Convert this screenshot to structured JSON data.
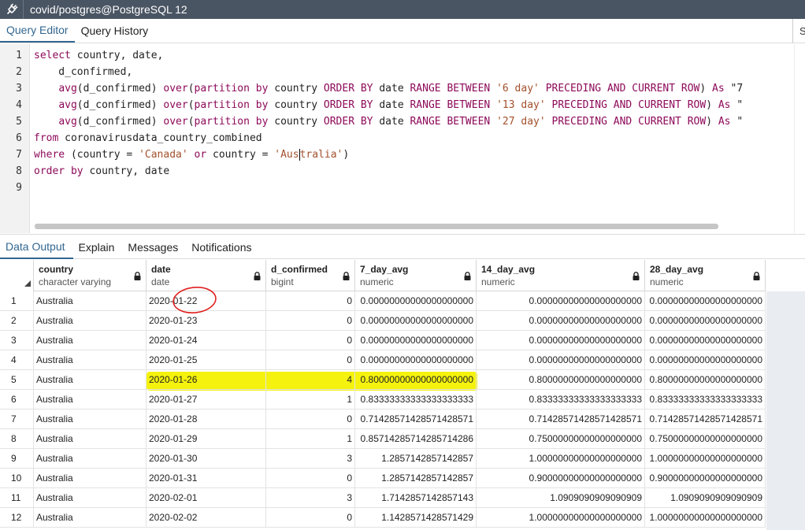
{
  "window": {
    "title": "covid/postgres@PostgreSQL 12",
    "app_icon": "plug-icon"
  },
  "editor_tabs": [
    {
      "label": "Query Editor",
      "active": true
    },
    {
      "label": "Query History",
      "active": false
    }
  ],
  "editor_tabs_overflow": "S",
  "editor": {
    "line_numbers": [
      "1",
      "2",
      "3",
      "4",
      "5",
      "6",
      "7",
      "8",
      "9"
    ],
    "lines": [
      [
        {
          "k": "kw",
          "t": "select"
        },
        {
          "k": "",
          "t": " country, date,"
        }
      ],
      [
        {
          "k": "",
          "t": "    d_confirmed,"
        }
      ],
      [
        {
          "k": "",
          "t": "    "
        },
        {
          "k": "kw",
          "t": "avg"
        },
        {
          "k": "",
          "t": "(d_confirmed) "
        },
        {
          "k": "kw",
          "t": "over"
        },
        {
          "k": "",
          "t": "("
        },
        {
          "k": "kw",
          "t": "partition by"
        },
        {
          "k": "",
          "t": " country "
        },
        {
          "k": "kw",
          "t": "ORDER BY"
        },
        {
          "k": "",
          "t": " date "
        },
        {
          "k": "kw",
          "t": "RANGE BETWEEN"
        },
        {
          "k": "",
          "t": " "
        },
        {
          "k": "str",
          "t": "'6 day'"
        },
        {
          "k": "",
          "t": " "
        },
        {
          "k": "kw",
          "t": "PRECEDING AND CURRENT ROW"
        },
        {
          "k": "",
          "t": ") "
        },
        {
          "k": "kw",
          "t": "As"
        },
        {
          "k": "",
          "t": " \"7"
        }
      ],
      [
        {
          "k": "",
          "t": "    "
        },
        {
          "k": "kw",
          "t": "avg"
        },
        {
          "k": "",
          "t": "(d_confirmed) "
        },
        {
          "k": "kw",
          "t": "over"
        },
        {
          "k": "",
          "t": "("
        },
        {
          "k": "kw",
          "t": "partition by"
        },
        {
          "k": "",
          "t": " country "
        },
        {
          "k": "kw",
          "t": "ORDER BY"
        },
        {
          "k": "",
          "t": " date "
        },
        {
          "k": "kw",
          "t": "RANGE BETWEEN"
        },
        {
          "k": "",
          "t": " "
        },
        {
          "k": "str",
          "t": "'13 day'"
        },
        {
          "k": "",
          "t": " "
        },
        {
          "k": "kw",
          "t": "PRECEDING AND CURRENT ROW"
        },
        {
          "k": "",
          "t": ") "
        },
        {
          "k": "kw",
          "t": "As"
        },
        {
          "k": "",
          "t": " \""
        }
      ],
      [
        {
          "k": "",
          "t": "    "
        },
        {
          "k": "kw",
          "t": "avg"
        },
        {
          "k": "",
          "t": "(d_confirmed) "
        },
        {
          "k": "kw",
          "t": "over"
        },
        {
          "k": "",
          "t": "("
        },
        {
          "k": "kw",
          "t": "partition by"
        },
        {
          "k": "",
          "t": " country "
        },
        {
          "k": "kw",
          "t": "ORDER BY"
        },
        {
          "k": "",
          "t": " date "
        },
        {
          "k": "kw",
          "t": "RANGE BETWEEN"
        },
        {
          "k": "",
          "t": " "
        },
        {
          "k": "str",
          "t": "'27 day'"
        },
        {
          "k": "",
          "t": " "
        },
        {
          "k": "kw",
          "t": "PRECEDING AND CURRENT ROW"
        },
        {
          "k": "",
          "t": ") "
        },
        {
          "k": "kw",
          "t": "As"
        },
        {
          "k": "",
          "t": " \""
        }
      ],
      [
        {
          "k": "kw",
          "t": "from"
        },
        {
          "k": "",
          "t": " coronavirusdata_country_combined"
        }
      ],
      [
        {
          "k": "kw",
          "t": "where"
        },
        {
          "k": "",
          "t": " (country = "
        },
        {
          "k": "str",
          "t": "'Canada'"
        },
        {
          "k": "",
          "t": " "
        },
        {
          "k": "kw",
          "t": "or"
        },
        {
          "k": "",
          "t": " country = "
        },
        {
          "k": "str",
          "t": "'Aus"
        },
        {
          "k": "cursor",
          "t": ""
        },
        {
          "k": "str",
          "t": "tralia'"
        },
        {
          "k": "",
          "t": ")"
        }
      ],
      [
        {
          "k": "kw",
          "t": "order by"
        },
        {
          "k": "",
          "t": " country, date"
        }
      ],
      []
    ]
  },
  "output_tabs": [
    {
      "label": "Data Output",
      "active": true
    },
    {
      "label": "Explain",
      "active": false
    },
    {
      "label": "Messages",
      "active": false
    },
    {
      "label": "Notifications",
      "active": false
    }
  ],
  "grid": {
    "columns": [
      {
        "name": "country",
        "type": "character varying"
      },
      {
        "name": "date",
        "type": "date"
      },
      {
        "name": "d_confirmed",
        "type": "bigint"
      },
      {
        "name": "7_day_avg",
        "type": "numeric"
      },
      {
        "name": "14_day_avg",
        "type": "numeric"
      },
      {
        "name": "28_day_avg",
        "type": "numeric"
      }
    ],
    "rows": [
      [
        "1",
        "Australia",
        "2020-01-22",
        "0",
        "0.00000000000000000000",
        "0.00000000000000000000",
        "0.00000000000000000000"
      ],
      [
        "2",
        "Australia",
        "2020-01-23",
        "0",
        "0.00000000000000000000",
        "0.00000000000000000000",
        "0.00000000000000000000"
      ],
      [
        "3",
        "Australia",
        "2020-01-24",
        "0",
        "0.00000000000000000000",
        "0.00000000000000000000",
        "0.00000000000000000000"
      ],
      [
        "4",
        "Australia",
        "2020-01-25",
        "0",
        "0.00000000000000000000",
        "0.00000000000000000000",
        "0.00000000000000000000"
      ],
      [
        "5",
        "Australia",
        "2020-01-26",
        "4",
        "0.80000000000000000000",
        "0.80000000000000000000",
        "0.80000000000000000000"
      ],
      [
        "6",
        "Australia",
        "2020-01-27",
        "1",
        "0.83333333333333333333",
        "0.83333333333333333333",
        "0.83333333333333333333"
      ],
      [
        "7",
        "Australia",
        "2020-01-28",
        "0",
        "0.71428571428571428571",
        "0.71428571428571428571",
        "0.71428571428571428571"
      ],
      [
        "8",
        "Australia",
        "2020-01-29",
        "1",
        "0.85714285714285714286",
        "0.75000000000000000000",
        "0.75000000000000000000"
      ],
      [
        "9",
        "Australia",
        "2020-01-30",
        "3",
        "1.2857142857142857",
        "1.00000000000000000000",
        "1.00000000000000000000"
      ],
      [
        "10",
        "Australia",
        "2020-01-31",
        "0",
        "1.2857142857142857",
        "0.90000000000000000000",
        "0.90000000000000000000"
      ],
      [
        "11",
        "Australia",
        "2020-02-01",
        "3",
        "1.7142857142857143",
        "1.0909090909090909",
        "1.0909090909090909"
      ],
      [
        "12",
        "Australia",
        "2020-02-02",
        "0",
        "1.1428571428571429",
        "1.00000000000000000000",
        "1.00000000000000000000"
      ]
    ],
    "highlighted_row": "5",
    "circled_cell_row": "1"
  },
  "colors": {
    "titlebar": "#4a5563",
    "accent": "#326690",
    "keyword": "#8d0a5a",
    "string": "#a3502c",
    "highlight": "#f4f200",
    "annotation": "#e0201f"
  }
}
